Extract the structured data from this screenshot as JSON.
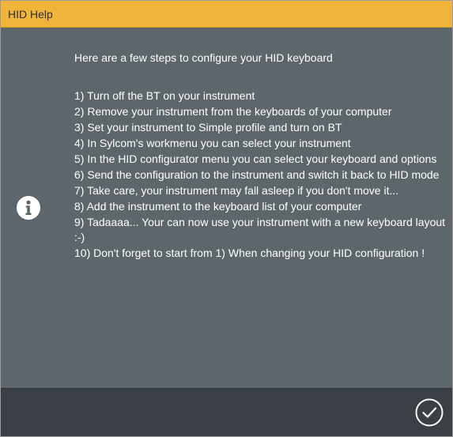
{
  "dialog": {
    "title": "HID Help",
    "icon": "info-icon",
    "intro": "Here are a few steps to configure your HID keyboard",
    "steps": [
      " 1) Turn off the BT on your instrument",
      " 2) Remove your instrument from the keyboards of your computer",
      " 3) Set your instrument to Simple profile and turn on BT",
      " 4) In Sylcom's workmenu you can select your instrument",
      " 5) In the HID configurator menu you can select your keyboard and options",
      " 6) Send the configuration to the instrument and switch it back to HID mode",
      " 7) Take care, your instrument may fall asleep if you don't move it...",
      " 8) Add the instrument to the keyboard list of your computer",
      " 9) Tadaaaa... Your can now use your instrument with a new keyboard layout :-)",
      "10) Don't forget to start from 1) When changing your HID configuration !"
    ],
    "confirm_icon": "checkmark-circle-icon"
  },
  "colors": {
    "title_bar": "#f0b43a",
    "body": "#5d666b",
    "footer": "#3a4045",
    "text": "#ffffff"
  }
}
